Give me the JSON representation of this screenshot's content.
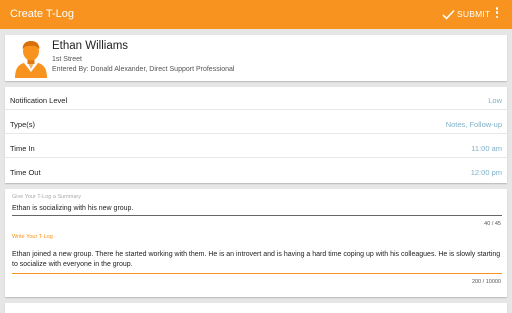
{
  "appbar": {
    "title": "Create T-Log",
    "submit_label": "SUBMIT",
    "submit_icon": "check-icon",
    "menu_icon": "more-vertical-icon",
    "accent_color": "#f7931e"
  },
  "profile": {
    "name": "Ethan Williams",
    "address": "1st Street",
    "entered_by": "Entered By: Donald Alexander, Direct Support Professional",
    "avatar_icon": "person-avatar-icon"
  },
  "details": [
    {
      "label": "Notification Level",
      "value": "Low"
    },
    {
      "label": "Type(s)",
      "value": "Notes, Follow-up"
    },
    {
      "label": "Time In",
      "value": "11:00 am"
    },
    {
      "label": "Time Out",
      "value": "12:00 pm"
    }
  ],
  "summary": {
    "hint": "Give Your T-Log a Summary",
    "value": "Ethan is socializing with his new group.",
    "counter": "40 / 45"
  },
  "tlog": {
    "hint": "Write Your T-Log",
    "value": "Ethan joined a new group. There he started working with them. He is an introvert and is having a hard time coping up with his colleagues. He is slowly starting to socialize with everyone in the group.",
    "counter": "200 / 10000"
  }
}
